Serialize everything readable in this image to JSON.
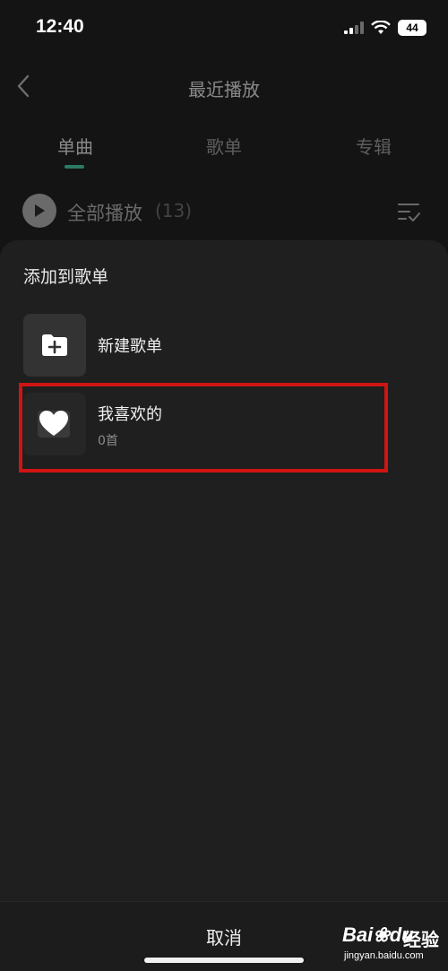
{
  "status_bar": {
    "time": "12:40",
    "battery": "44"
  },
  "header": {
    "title": "最近播放"
  },
  "tabs": [
    {
      "label": "单曲",
      "active": true
    },
    {
      "label": "歌单",
      "active": false
    },
    {
      "label": "专辑",
      "active": false
    }
  ],
  "play_all": {
    "label": "全部播放",
    "count": "(13)"
  },
  "sheet": {
    "title": "添加到歌单",
    "items": [
      {
        "name": "新建歌单",
        "icon": "folder-plus-icon"
      },
      {
        "name": "我喜欢的",
        "count": "0首",
        "icon": "heart-icon"
      }
    ],
    "cancel_label": "取消"
  },
  "watermark": {
    "brand": "Bai",
    "brand_tail": "du",
    "experience": "经验",
    "url": "jingyan.baidu.com"
  },
  "colors": {
    "background": "#141414",
    "sheet": "#1f1f1f",
    "accent": "#2a7a66",
    "highlight": "#d01414"
  }
}
